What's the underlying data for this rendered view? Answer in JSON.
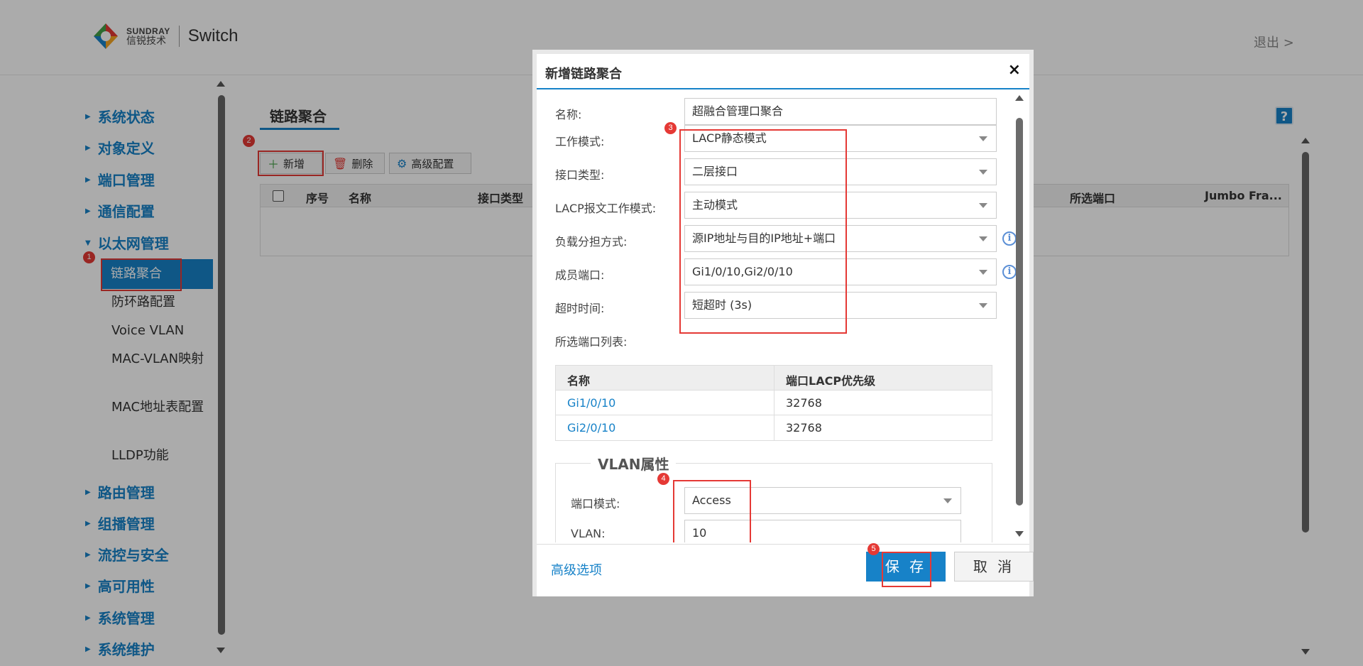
{
  "header": {
    "brand_en": "SUNDRAY",
    "brand_cn": "信锐技术",
    "product": "Switch",
    "logout": "退出 >"
  },
  "sidebar": {
    "groups": [
      "系统状态",
      "对象定义",
      "端口管理",
      "通信配置",
      "以太网管理",
      "路由管理",
      "组播管理",
      "流控与安全",
      "高可用性",
      "系统管理",
      "系统维护"
    ],
    "sub_items": [
      "链路聚合",
      "防环路配置",
      "Voice VLAN",
      "MAC-VLAN映射",
      "MAC地址表配置",
      "LLDP功能"
    ]
  },
  "main": {
    "title": "链路聚合",
    "toolbar": {
      "add": "新增",
      "delete": "删除",
      "advanced": "高级配置"
    },
    "columns": [
      "序号",
      "名称",
      "接口类型",
      "所选端口",
      "Jumbo Fra..."
    ]
  },
  "dialog": {
    "title": "新增链路聚合",
    "close": "×",
    "fields": {
      "name_label": "名称:",
      "name_value": "超融合管理口聚合",
      "mode_label": "工作模式:",
      "mode_value": "LACP静态模式",
      "iface_label": "接口类型:",
      "iface_value": "二层接口",
      "lacp_label": "LACP报文工作模式:",
      "lacp_value": "主动模式",
      "load_label": "负载分担方式:",
      "load_value": "源IP地址与目的IP地址+端口",
      "member_label": "成员端口:",
      "member_value": "Gi1/0/10,Gi2/0/10",
      "timeout_label": "超时时间:",
      "timeout_value": "短超时 (3s)",
      "list_label": "所选端口列表:"
    },
    "port_table": {
      "headers": [
        "名称",
        "端口LACP优先级"
      ],
      "rows": [
        {
          "name": "Gi1/0/10",
          "priority": "32768"
        },
        {
          "name": "Gi2/0/10",
          "priority": "32768"
        }
      ]
    },
    "vlan": {
      "legend": "VLAN属性",
      "port_mode_label": "端口模式:",
      "port_mode_value": "Access",
      "vlan_label": "VLAN:",
      "vlan_value": "10"
    },
    "footer": {
      "advanced": "高级选项",
      "save": "保 存",
      "cancel": "取 消"
    }
  },
  "annotations": [
    "1",
    "2",
    "3",
    "4",
    "5"
  ],
  "colors": {
    "accent": "#1782c8",
    "highlight": "#e53935"
  }
}
